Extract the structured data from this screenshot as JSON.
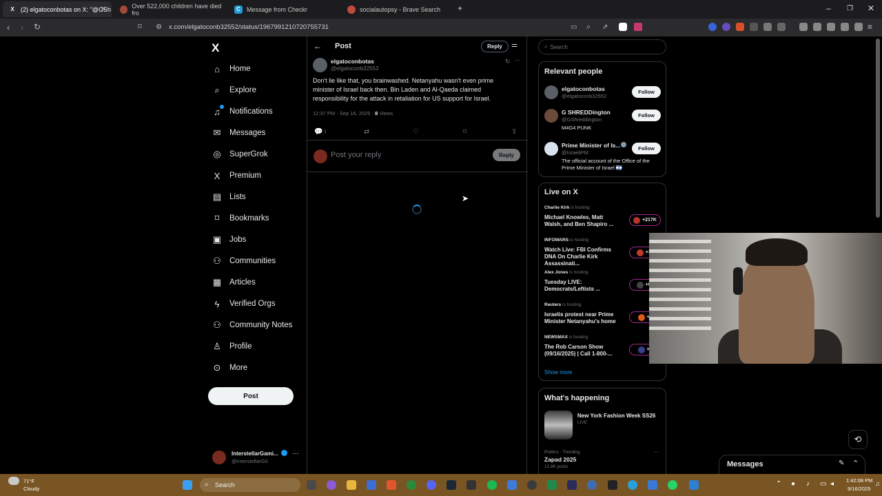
{
  "browser": {
    "tabs": [
      {
        "label": "(2) elgatoconbotas on X: \"@GSh",
        "icon": "x-icon",
        "active": true
      },
      {
        "label": "Over 522,000 children have died fro",
        "icon": "brave-icon",
        "active": false
      },
      {
        "label": "Message from Checkr",
        "icon": "checkr-icon",
        "active": false
      },
      {
        "label": "socialautopsy - Brave Search",
        "icon": "brave-search-icon",
        "active": false
      }
    ],
    "new_tab": "+",
    "url": "x.com/elgatoconb32552/status/1967991210720755731"
  },
  "nav": {
    "logo": "X",
    "items": [
      {
        "label": "Home",
        "icon": "home-icon",
        "glyph": "⌂"
      },
      {
        "label": "Explore",
        "icon": "search-icon",
        "glyph": "⌕"
      },
      {
        "label": "Notifications",
        "icon": "bell-icon",
        "glyph": "♫"
      },
      {
        "label": "Messages",
        "icon": "mail-icon",
        "glyph": "✉"
      },
      {
        "label": "SuperGrok",
        "icon": "grok-icon",
        "glyph": "◎"
      },
      {
        "label": "Premium",
        "icon": "x-premium-icon",
        "glyph": "X"
      },
      {
        "label": "Lists",
        "icon": "list-icon",
        "glyph": "▤"
      },
      {
        "label": "Bookmarks",
        "icon": "bookmark-icon",
        "glyph": "⌑"
      },
      {
        "label": "Jobs",
        "icon": "briefcase-icon",
        "glyph": "▣"
      },
      {
        "label": "Communities",
        "icon": "people-icon",
        "glyph": "⚇"
      },
      {
        "label": "Articles",
        "icon": "article-icon",
        "glyph": "▦"
      },
      {
        "label": "Verified Orgs",
        "icon": "lightning-icon",
        "glyph": "ϟ"
      },
      {
        "label": "Community Notes",
        "icon": "notes-icon",
        "glyph": "⚇"
      },
      {
        "label": "Profile",
        "icon": "person-icon",
        "glyph": "♙"
      },
      {
        "label": "More",
        "icon": "more-circle-icon",
        "glyph": "⊙"
      }
    ],
    "post_label": "Post",
    "account": {
      "name": "InterstellarGami...",
      "handle": "@InterstellarG0"
    }
  },
  "center": {
    "header_title": "Post",
    "reply_label": "Reply",
    "tweet": {
      "name": "elgatoconbotas",
      "handle": "@elgatoconb32552",
      "text": "Don't lie like that, you brainwashed. Netanyahu wasn't even prime minister of Israel back then. Bin Laden and Al-Qaeda claimed responsibility for the attack in retaliation for US support for Israel.",
      "time": "12:37 PM · Sep 16, 2025 · ",
      "views_count": "8",
      "views_label": " Views",
      "reply_count": "1"
    },
    "reply_placeholder": "Post your reply",
    "reply_button": "Reply"
  },
  "right": {
    "search_placeholder": "Search",
    "relevant_title": "Relevant people",
    "people": [
      {
        "name": "elgatoconbotas",
        "handle": "@elgatoconb32552",
        "bio": "",
        "follow": "Follow"
      },
      {
        "name": "G SHREDDington",
        "handle": "@GShreddington",
        "bio": "M4G4 PUNK",
        "follow": "Follow"
      },
      {
        "name": "Prime Minister of Is...",
        "handle": "@IsraeliPM",
        "bio": "The official account of the Office of the Prime Minister of Israel 🇮🇱",
        "follow": "Follow"
      }
    ],
    "live_title": "Live on X",
    "live": [
      {
        "host": "Charlie Kirk",
        "hosting": " is hosting",
        "title": "Michael Knowles, Matt Walsh, and Ben Shapiro ...",
        "count": "+217K"
      },
      {
        "host": "INFOWARS",
        "hosting": " is hosting",
        "title": "Watch Live: FBI Confirms DNA On Charlie Kirk Assassinati...",
        "count": "+11"
      },
      {
        "host": "Alex Jones",
        "hosting": " is hosting",
        "title": "Tuesday LIVE: Democrats/Leftists ...",
        "count": "+92"
      },
      {
        "host": "Reuters",
        "hosting": " is hosting",
        "title": "Israelis protest near Prime Minister Netanyahu's home",
        "count": "+8"
      },
      {
        "host": "NEWSMAX",
        "hosting": " is hosting",
        "title": "The Rob Carson Show (09/16/2025) | Call 1-800-...",
        "count": "+6"
      }
    ],
    "show_more": "Show more",
    "happening_title": "What's happening",
    "trends": [
      {
        "title": "New York Fashion Week SS26",
        "sub": "LIVE"
      },
      {
        "context": "Politics · Trending",
        "title": "Zapad 2025",
        "posts": "12.8K posts"
      }
    ]
  },
  "messages_dock": {
    "label": "Messages"
  },
  "taskbar": {
    "weather_temp": "71°F",
    "weather_desc": "Cloudy",
    "search_label": "Search",
    "time": "1:42:08 PM",
    "date": "9/16/2025"
  }
}
